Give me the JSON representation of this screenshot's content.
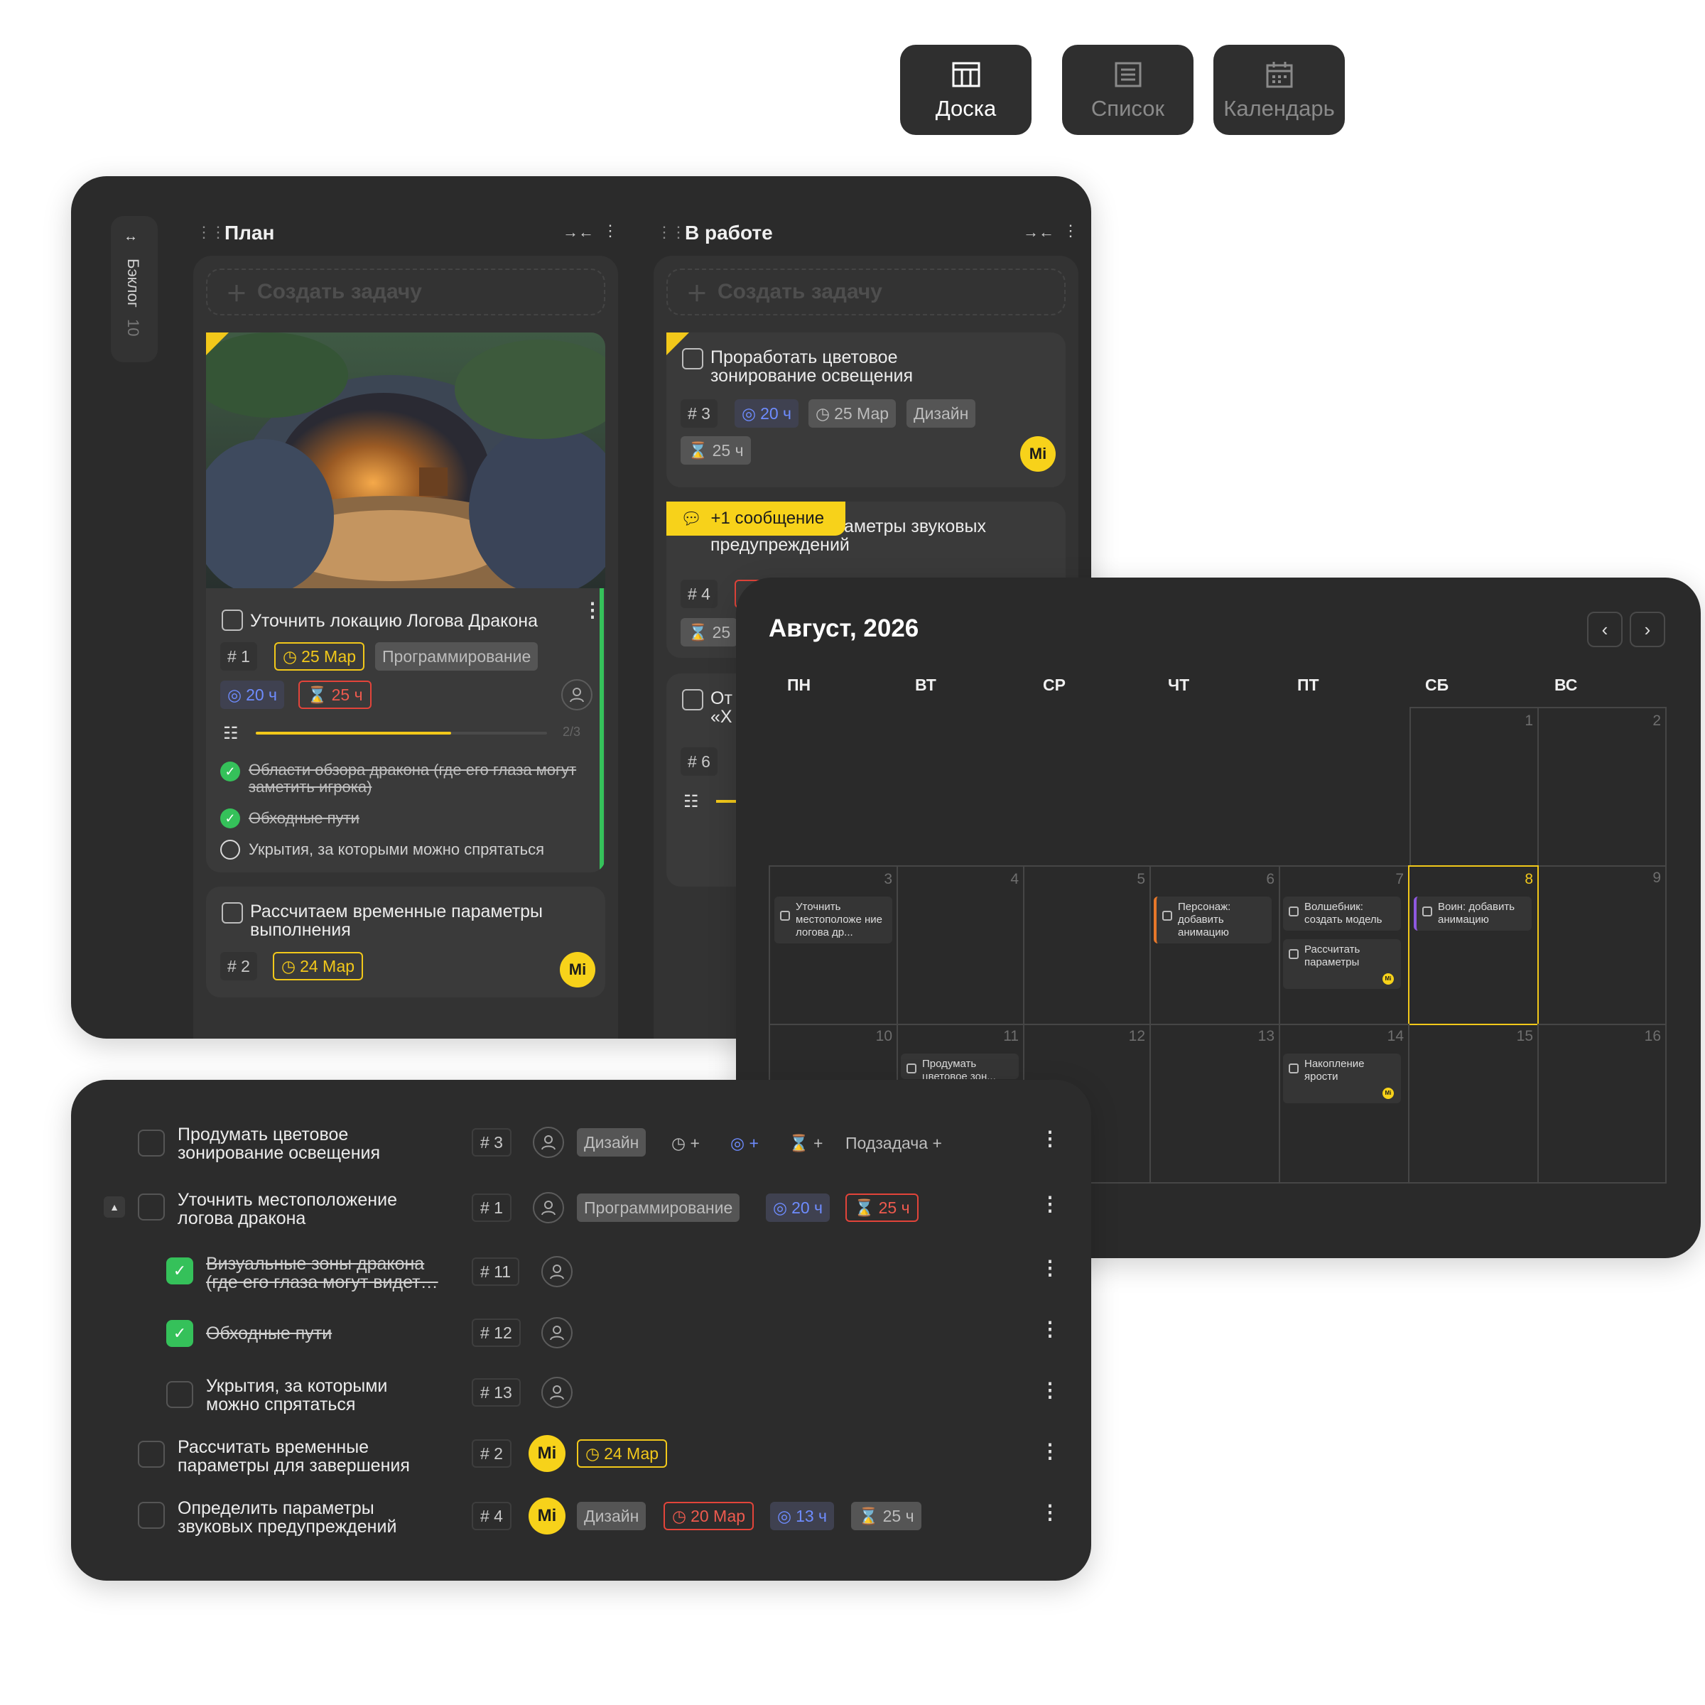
{
  "views": [
    {
      "label": "Доска",
      "icon": "board-icon",
      "active": true
    },
    {
      "label": "Список",
      "icon": "list-icon",
      "active": false
    },
    {
      "label": "Календарь",
      "icon": "calendar-icon",
      "active": false
    }
  ],
  "colors": {
    "accent": "#f2c81a",
    "bg": "#2b2b2b",
    "danger": "#e2443a",
    "success": "#35c15a",
    "info": "#6e8cff"
  },
  "board": {
    "backlog": {
      "label": "Бэклог",
      "count": "10"
    },
    "columns": [
      {
        "title": "План",
        "create": "Создать задачу"
      },
      {
        "title": "В работе",
        "create": "Создать задачу"
      }
    ],
    "plan_cards": [
      {
        "title": "Уточнить локацию Логова Дракона",
        "id": "# 1",
        "date": "25 Мар",
        "tag": "Программирование",
        "estimate": "20 ч",
        "spent": "25 ч",
        "progress": "2/3",
        "progress_value": 0.67,
        "subtasks": [
          {
            "text": "Области обзора дракона (где его глаза могут заметить игрока)",
            "done": true
          },
          {
            "text": "Обходные пути",
            "done": true
          },
          {
            "text": "Укрытия, за которыми можно спрятаться",
            "done": false
          }
        ]
      },
      {
        "title": "Рассчитаем временные параметры выполнения",
        "id": "# 2",
        "date": "24 Мар",
        "avatar": "Mi"
      }
    ],
    "work_cards": [
      {
        "title": "Проработать цветовое зонирование освещения",
        "id": "# 3",
        "estimate": "20 ч",
        "date": "25 Мар",
        "tag": "Дизайн",
        "spent": "25 ч",
        "avatar": "Mi"
      },
      {
        "badge": "+1 сообщение",
        "title_tail": "аметры звуковых",
        "title_line2": "предупреждений",
        "id": "# 4",
        "spent": "25"
      },
      {
        "title_start": "От",
        "title_line2": "«Х",
        "id": "# 6"
      }
    ]
  },
  "calendar": {
    "title": "Август, 2026",
    "weekdays": [
      "ПН",
      "ВТ",
      "СР",
      "ЧТ",
      "ПТ",
      "СБ",
      "ВС"
    ],
    "days": [
      "1",
      "2",
      "3",
      "4",
      "5",
      "6",
      "7",
      "8",
      "9",
      "10",
      "11",
      "12",
      "13",
      "14",
      "15",
      "16"
    ],
    "events": {
      "e3": "Уточнить местоположе ние логова др...",
      "e6": "Персонаж: добавить анимацию",
      "e7a": "Волшебник: создать модель",
      "e7b": "Рассчитать параметры",
      "e8": "Воин: добавить анимацию",
      "e11": "Продумать цветовое зон...",
      "e14": "Накопление ярости"
    },
    "avatar": "Mi"
  },
  "list": {
    "rows": [
      {
        "title": "Продумать цветовое зонирование освещения",
        "id": "# 3",
        "tag": "Дизайн",
        "add_date": "+",
        "add_est": "+",
        "add_spent": "+",
        "add_sub": "Подзадача +"
      },
      {
        "title": "Уточнить местоположение логова дракона",
        "id": "# 1",
        "tag": "Программирование",
        "estimate": "20 ч",
        "spent": "25 ч"
      },
      {
        "title": "Визуальные зоны дракона (где его глаза могут видет…",
        "id": "# 11",
        "done": true
      },
      {
        "title": "Обходные пути",
        "id": "# 12",
        "done": true
      },
      {
        "title": "Укрытия, за которыми можно спрятаться",
        "id": "# 13",
        "done": false
      },
      {
        "title": "Рассчитать временные параметры для завершения",
        "id": "# 2",
        "avatar": "Mi",
        "date": "24 Мар"
      },
      {
        "title": "Определить параметры звуковых предупреждений",
        "id": "# 4",
        "avatar": "Mi",
        "tag": "Дизайн",
        "date": "20 Мар",
        "estimate": "13 ч",
        "spent": "25 ч"
      }
    ]
  }
}
